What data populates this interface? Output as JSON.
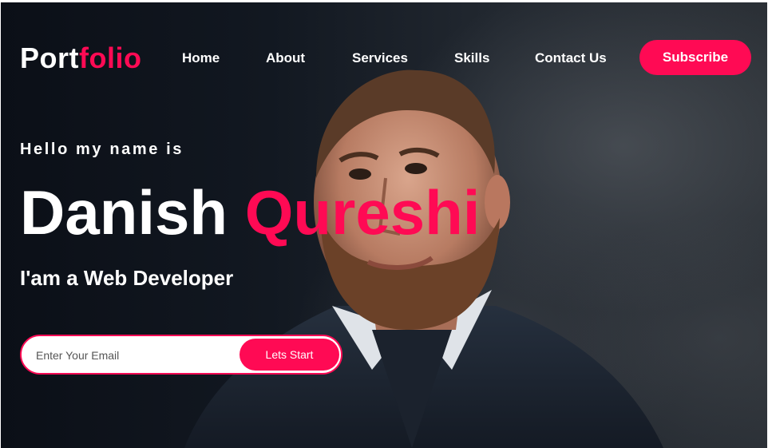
{
  "header": {
    "logo_part1": "Port",
    "logo_part2": "folio",
    "nav": [
      "Home",
      "About",
      "Services",
      "Skills",
      "Contact Us"
    ],
    "subscribe_label": "Subscribe"
  },
  "hero": {
    "greeting": "Hello my name is",
    "first_name": "Danish",
    "last_name": "Qureshi",
    "role": "I'am a Web Developer",
    "email_placeholder": "Enter Your Email",
    "cta_label": "Lets Start",
    "image_icon": "portrait-photo"
  },
  "colors": {
    "accent": "#ff0a54",
    "text": "#ffffff",
    "background": "#10151d"
  }
}
